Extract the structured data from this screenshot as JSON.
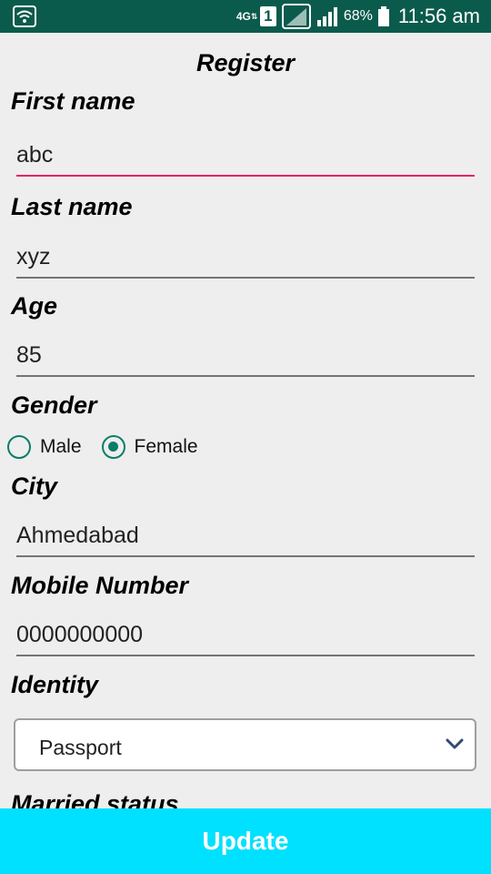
{
  "status_bar": {
    "network_type": "4G",
    "network_arrows": "⇅",
    "sim_slot": "1",
    "battery_percent": "68%",
    "time": "11:56 am",
    "colors": {
      "background": "#0b5b4c",
      "foreground": "#ffffff"
    }
  },
  "form": {
    "title": "Register",
    "first_name": {
      "label": "First name",
      "value": "abc",
      "focused": true
    },
    "last_name": {
      "label": "Last name",
      "value": "xyz"
    },
    "age": {
      "label": "Age",
      "value": "85"
    },
    "gender": {
      "label": "Gender",
      "options": [
        {
          "label": "Male",
          "checked": false
        },
        {
          "label": "Female",
          "checked": true
        }
      ]
    },
    "city": {
      "label": "City",
      "value": "Ahmedabad"
    },
    "mobile": {
      "label": "Mobile Number",
      "value": "0000000000"
    },
    "identity": {
      "label": "Identity",
      "selected": "Passport"
    },
    "married_status": {
      "label": "Married status"
    }
  },
  "update_button": {
    "label": "Update",
    "color": "#00e0ff"
  },
  "icons": [
    "wifi-icon",
    "sim-icon",
    "no-sim-icon",
    "signal-icon",
    "battery-icon",
    "chevron-down-icon"
  ],
  "colors": {
    "focus_underline": "#e91e63",
    "radio_accent": "#0b7d68",
    "background": "#eeeeee"
  }
}
